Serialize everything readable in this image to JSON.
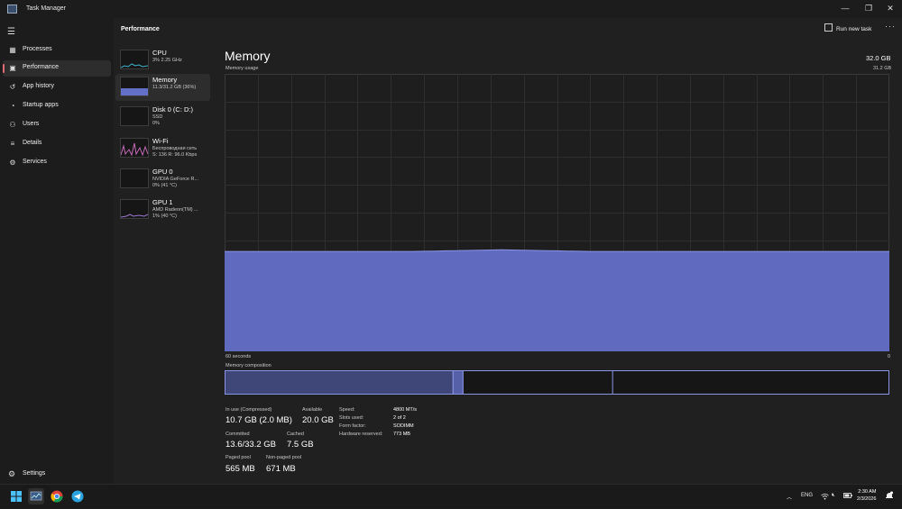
{
  "window": {
    "title": "Task Manager"
  },
  "sidebar": {
    "items": [
      {
        "label": "Processes",
        "icon": "processes-icon"
      },
      {
        "label": "Performance",
        "icon": "performance-icon",
        "active": true
      },
      {
        "label": "App history",
        "icon": "app-history-icon"
      },
      {
        "label": "Startup apps",
        "icon": "startup-apps-icon"
      },
      {
        "label": "Users",
        "icon": "users-icon"
      },
      {
        "label": "Details",
        "icon": "details-icon"
      },
      {
        "label": "Services",
        "icon": "services-icon"
      }
    ],
    "settings_label": "Settings"
  },
  "header": {
    "title": "Performance",
    "run_new_task": "Run new task"
  },
  "devices": [
    {
      "name": "CPU",
      "line1": "3% 2.25 GHz",
      "line2": ""
    },
    {
      "name": "Memory",
      "line1": "11.3/31.2 GB (36%)",
      "line2": "",
      "active": true
    },
    {
      "name": "Disk 0 (C: D:)",
      "line1": "SSD",
      "line2": "0%"
    },
    {
      "name": "Wi-Fi",
      "line1": "Беспроводная сеть",
      "line2": "S: 136 R: 96.0 Kbps"
    },
    {
      "name": "GPU 0",
      "line1": "NVIDIA GeForce R...",
      "line2": "0% (41 °C)"
    },
    {
      "name": "GPU 1",
      "line1": "AMD Radeon(TM) ...",
      "line2": "1% (40 °C)"
    }
  ],
  "memory": {
    "title": "Memory",
    "total": "32.0 GB",
    "usage_label": "Memory usage",
    "usage_max": "31.2 GB",
    "x_left": "60 seconds",
    "x_right": "0",
    "composition_label": "Memory composition",
    "usage_fraction": 0.36,
    "composition": {
      "in_use": 0.343,
      "modified": 0.015,
      "standby": 0.225
    },
    "stats": {
      "in_use_label": "In use (Compressed)",
      "in_use_value": "10.7 GB (2.0 MB)",
      "available_label": "Available",
      "available_value": "20.0 GB",
      "committed_label": "Committed",
      "committed_value": "13.6/33.2 GB",
      "cached_label": "Cached",
      "cached_value": "7.5 GB",
      "paged_label": "Paged pool",
      "paged_value": "565 MB",
      "nonpaged_label": "Non-paged pool",
      "nonpaged_value": "671 MB"
    },
    "details": [
      {
        "label": "Speed:",
        "value": "4800 MT/s"
      },
      {
        "label": "Slots used:",
        "value": "2 of 2"
      },
      {
        "label": "Form factor:",
        "value": "SODIMM"
      },
      {
        "label": "Hardware reserved:",
        "value": "773 MB"
      }
    ]
  },
  "colors": {
    "memory_fill": "#6470c8",
    "memory_line": "#8b95e6",
    "accent": "#e06c75"
  },
  "taskbar": {
    "apps": [
      "windows-start-icon",
      "task-manager-app-icon",
      "chrome-app-icon",
      "telegram-app-icon"
    ],
    "lang": "ENG",
    "time": "2:30 AM",
    "date": "2/3/2026"
  }
}
